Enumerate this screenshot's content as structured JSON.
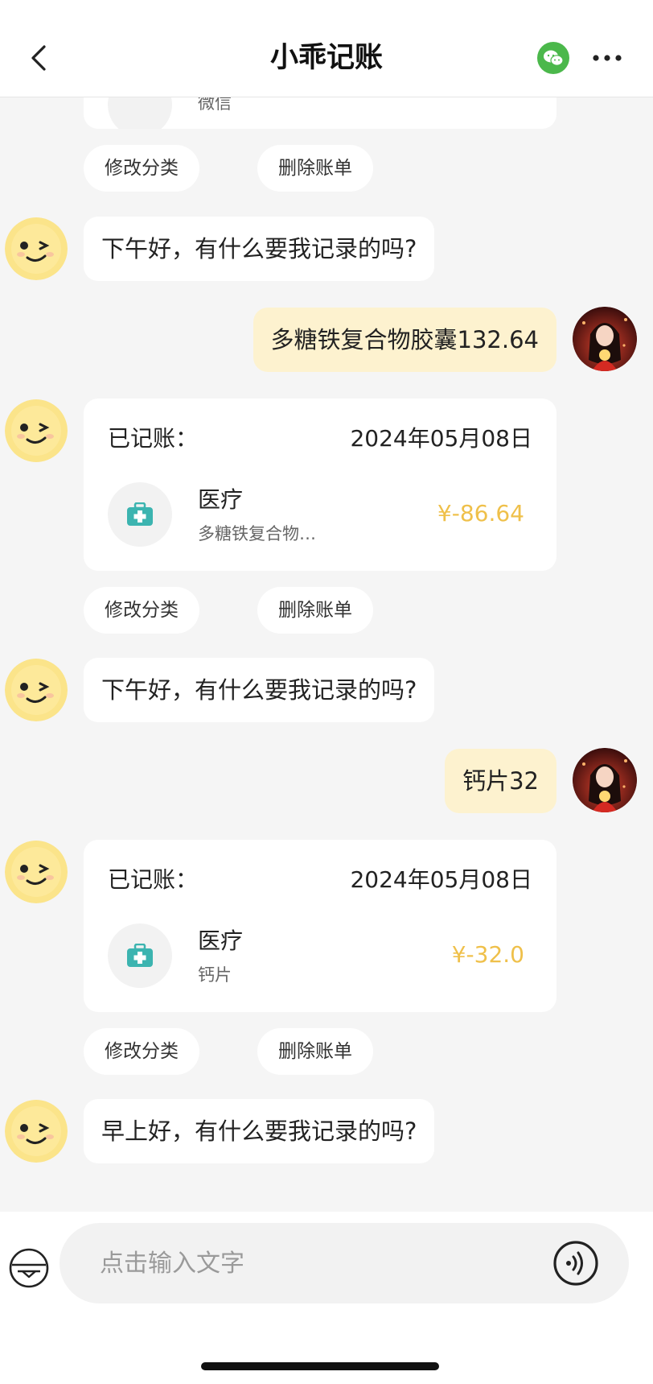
{
  "header": {
    "title": "小乖记账"
  },
  "icons": {
    "back": "chevron-left-icon",
    "wechat": "wechat-icon",
    "more": "more-dots-icon",
    "keyboard": "keyboard-icon",
    "voice": "voice-icon",
    "medical": "medical-kit-icon"
  },
  "colors": {
    "amount": "#efc04a",
    "user_bubble": "#fdf2cf",
    "wechat": "#4bb84b"
  },
  "chat": {
    "top_card": {
      "note_fragment": "微信"
    },
    "actions": {
      "edit": "修改分类",
      "delete": "删除账单"
    },
    "messages": [
      {
        "text": "下午好，有什么要我记录的吗?"
      },
      {
        "text": "多糖铁复合物胶囊132.64"
      },
      {
        "text": "下午好，有什么要我记录的吗?"
      },
      {
        "text": "钙片32"
      },
      {
        "text": "早上好，有什么要我记录的吗?"
      }
    ],
    "cards": [
      {
        "title": "已记账：",
        "date": "2024年05月08日",
        "category": "医疗",
        "note": "多糖铁复合物…",
        "amount": "¥-86.64"
      },
      {
        "title": "已记账：",
        "date": "2024年05月08日",
        "category": "医疗",
        "note": "钙片",
        "amount": "¥-32.0"
      }
    ]
  },
  "input": {
    "placeholder": "点击输入文字"
  }
}
